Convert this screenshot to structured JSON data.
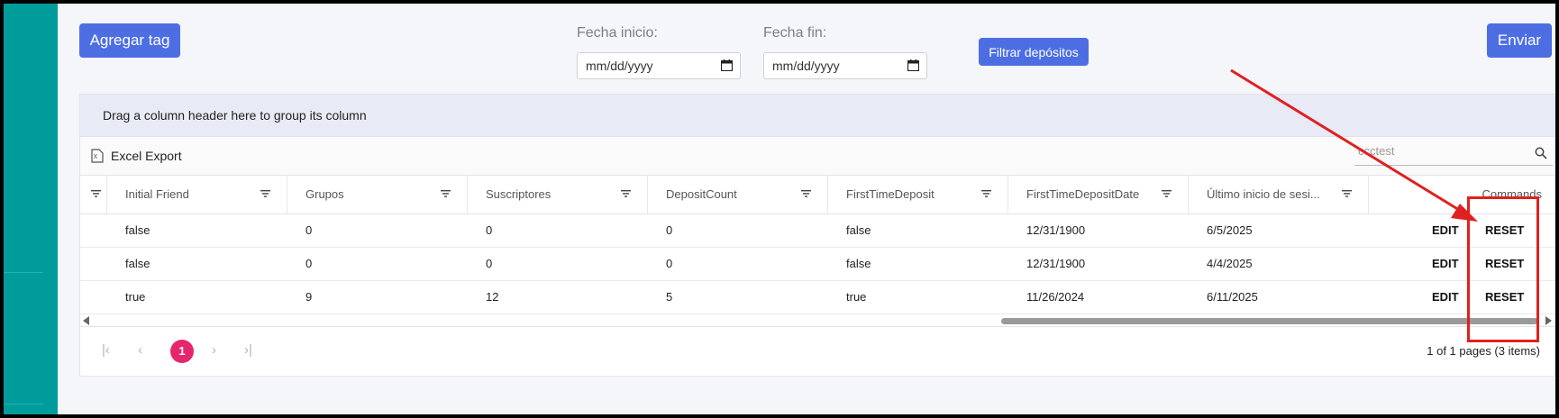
{
  "toolbar": {
    "add_tag_label": "Agregar tag",
    "start_date_label": "Fecha inicio:",
    "start_date_value": "mm/dd/yyyy",
    "end_date_label": "Fecha fin:",
    "end_date_value": "mm/dd/yyyy",
    "filter_label": "Filtrar depósitos",
    "send_label": "Enviar"
  },
  "grid": {
    "group_hint": "Drag a column header here to group its column",
    "export_label": "Excel Export",
    "search_placeholder": "ccctest",
    "columns": [
      "Initial Friend",
      "Grupos",
      "Suscriptores",
      "DepositCount",
      "FirstTimeDeposit",
      "FirstTimeDepositDate",
      "Último inicio de sesi...",
      "Commands"
    ],
    "rows": [
      {
        "initial_friend": "false",
        "grupos": "0",
        "suscriptores": "0",
        "deposit_count": "0",
        "first_time_deposit": "false",
        "first_time_deposit_date": "12/31/1900",
        "ultimo_inicio": "6/5/2025",
        "edit": "EDIT",
        "reset": "RESET"
      },
      {
        "initial_friend": "false",
        "grupos": "0",
        "suscriptores": "0",
        "deposit_count": "0",
        "first_time_deposit": "false",
        "first_time_deposit_date": "12/31/1900",
        "ultimo_inicio": "4/4/2025",
        "edit": "EDIT",
        "reset": "RESET"
      },
      {
        "initial_friend": "true",
        "grupos": "9",
        "suscriptores": "12",
        "deposit_count": "5",
        "first_time_deposit": "true",
        "first_time_deposit_date": "11/26/2024",
        "ultimo_inicio": "6/11/2025",
        "edit": "EDIT",
        "reset": "RESET"
      }
    ]
  },
  "pager": {
    "current_page": "1",
    "info": "1 of 1 pages (3 items)"
  },
  "colors": {
    "sidebar": "#009c9c",
    "primary_button": "#4d6ee3",
    "active_page": "#e6266c",
    "annotation": "#e02020"
  }
}
